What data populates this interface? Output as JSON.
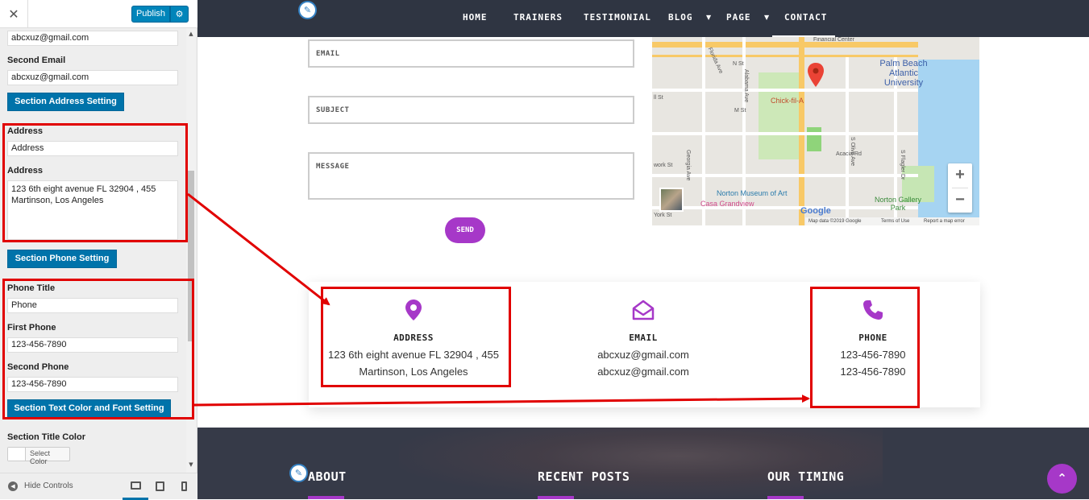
{
  "customizer": {
    "close_icon": "close-icon",
    "publish_label": "Publish",
    "settings_icon": "gear-icon",
    "first_email_value": "abcxuz@gmail.com",
    "second_email_label": "Second Email",
    "second_email_value": "abcxuz@gmail.com",
    "section_address_btn": "Section Address Setting",
    "address_title_label": "Address",
    "address_title_value": "Address",
    "address_label": "Address",
    "address_value": "123 6th eight avenue FL 32904 , 455 Martinson, Los Angeles",
    "section_phone_btn": "Section Phone Setting",
    "phone_title_label": "Phone Title",
    "phone_title_value": "Phone",
    "first_phone_label": "First Phone",
    "first_phone_value": "123-456-7890",
    "second_phone_label": "Second Phone",
    "second_phone_value": "123-456-7890",
    "section_text_color_btn": "Section Text Color and Font Setting",
    "section_title_color_label": "Section Title Color",
    "select_color_label": "Select Color",
    "hide_controls_label": "Hide Controls"
  },
  "nav": {
    "items": [
      "HOME",
      "TRAINERS",
      "TESTIMONIAL",
      "BLOG",
      "PAGE",
      "CONTACT"
    ],
    "active": "CONTACT"
  },
  "contact_form": {
    "email_placeholder": "EMAIL",
    "subject_placeholder": "SUBJECT",
    "message_placeholder": "MESSAGE",
    "send_label": "SEND"
  },
  "map": {
    "labels": {
      "financial_center": "Financial Center",
      "palm_beach": "Palm Beach Atlantic University",
      "chick_fil_a": "Chick-fil-A",
      "norton_museum": "Norton Museum of Art",
      "casa_grandview": "Casa Grandview",
      "norton_gallery_park": "Norton Gallery Park",
      "alabama_ave": "Alabama Ave",
      "m_st": "M St",
      "n_st": "N St",
      "ll_st": "ll St",
      "georgia_ave": "Georgia Ave",
      "olive_ave": "S Olive Ave",
      "acacia_rd": "Acacia Rd",
      "flagler_dr": "S Flagler Dr",
      "york_st": "York St",
      "work_st": "work St",
      "florida_ave": "Florida Ave",
      "google": "Google"
    },
    "footer": {
      "map_data": "Map data ©2019 Google",
      "terms": "Terms of Use",
      "report": "Report a map error"
    },
    "zoom_in": "+",
    "zoom_out": "−"
  },
  "info_card": {
    "address": {
      "title": "ADDRESS",
      "line1": "123 6th eight avenue FL 32904 , 455",
      "line2": "Martinson, Los Angeles"
    },
    "email": {
      "title": "EMAIL",
      "line1": "abcxuz@gmail.com",
      "line2": "abcxuz@gmail.com"
    },
    "phone": {
      "title": "PHONE",
      "line1": "123-456-7890",
      "line2": "123-456-7890"
    }
  },
  "footer": {
    "about": "ABOUT",
    "recent_posts": "RECENT POSTS",
    "our_timing": "OUR TIMING"
  },
  "colors": {
    "accent": "#a638c8",
    "nav_bg": "#2f3542",
    "wp_blue": "#0073aa",
    "annotation_red": "#e10000"
  }
}
